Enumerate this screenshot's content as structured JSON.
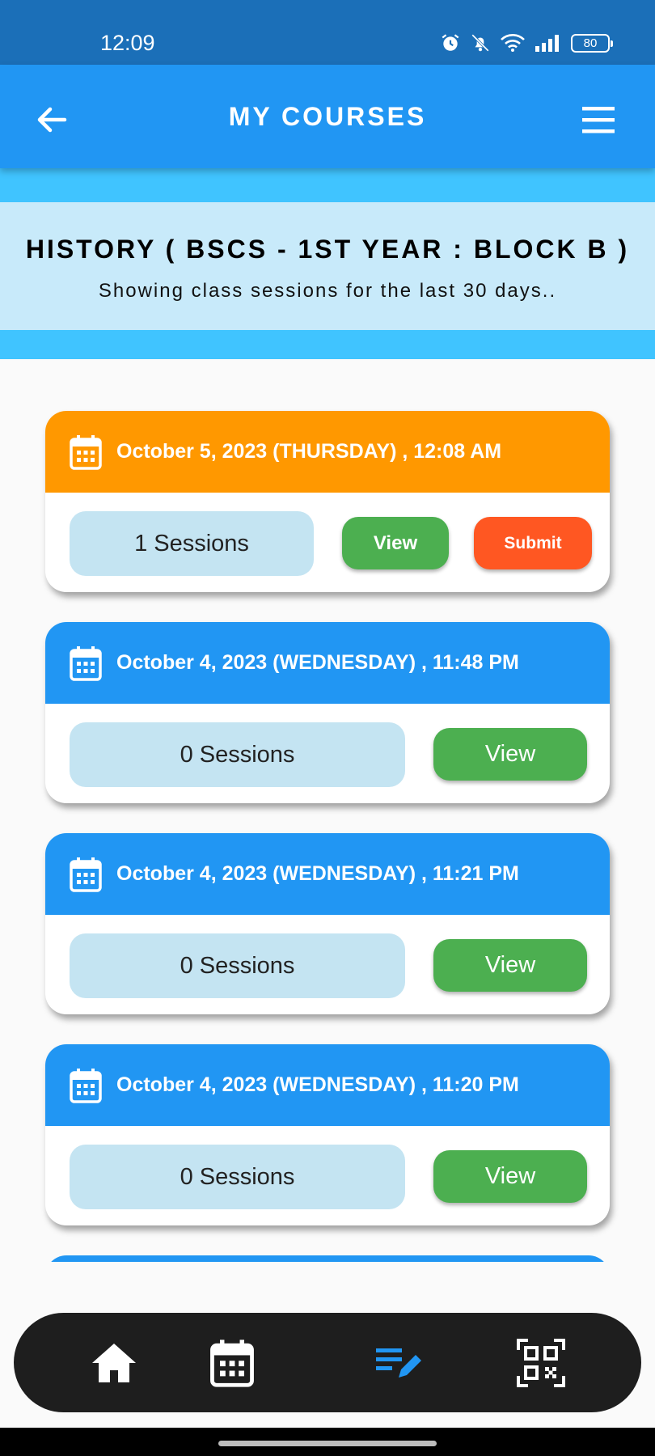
{
  "status_bar": {
    "time": "12:09",
    "battery": "80",
    "icons": [
      "alarm-icon",
      "bell-off-icon",
      "wifi-icon",
      "signal-icon",
      "battery-icon"
    ]
  },
  "app_bar": {
    "title": "MY COURSES",
    "back_icon": "arrow-left-icon",
    "menu_icon": "hamburger-menu-icon"
  },
  "header": {
    "title": "HISTORY ( BSCS - 1ST YEAR : BLOCK B )",
    "subtitle": "Showing class sessions for the last 30 days.."
  },
  "sessions": [
    {
      "date": "October 5, 2023 (THURSDAY) , 12:08 AM",
      "sessions_label": "1 Sessions",
      "view_label": "View",
      "submit_label": "Submit",
      "header_color": "#ff9800"
    },
    {
      "date": "October 4, 2023 (WEDNESDAY) , 11:48 PM",
      "sessions_label": "0 Sessions",
      "view_label": "View",
      "header_color": "#2196f3"
    },
    {
      "date": "October 4, 2023 (WEDNESDAY) , 11:21 PM",
      "sessions_label": "0 Sessions",
      "view_label": "View",
      "header_color": "#2196f3"
    },
    {
      "date": "October 4, 2023 (WEDNESDAY) , 11:20 PM",
      "sessions_label": "0 Sessions",
      "view_label": "View",
      "header_color": "#2196f3"
    }
  ],
  "bottom_nav": {
    "items": [
      {
        "icon": "home-icon",
        "active": false
      },
      {
        "icon": "calendar-icon",
        "active": false
      },
      {
        "icon": "edit-list-icon",
        "active": true
      },
      {
        "icon": "qr-code-icon",
        "active": false
      }
    ],
    "active_color": "#2196f3"
  },
  "colors": {
    "primary": "#2196f3",
    "status_bar": "#1b6fb8",
    "accent_band": "#40c4ff",
    "header_panel": "#c8eafa",
    "view_button": "#4caf50",
    "submit_button": "#ff5722"
  }
}
